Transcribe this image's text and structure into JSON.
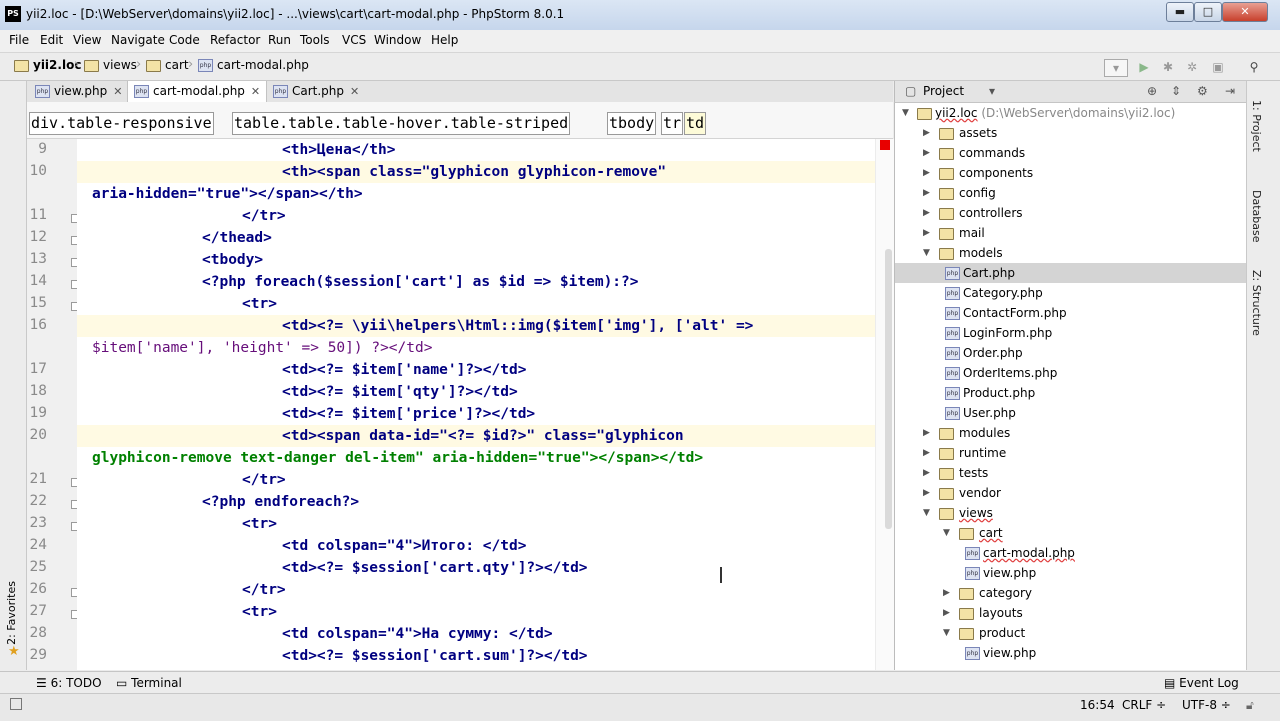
{
  "window": {
    "title": "yii2.loc - [D:\\WebServer\\domains\\yii2.loc] - ...\\views\\cart\\cart-modal.php - PhpStorm 8.0.1",
    "app_icon": "PS",
    "minimize": "▬",
    "maximize": "□",
    "close": "✕"
  },
  "menu": [
    "File",
    "Edit",
    "View",
    "Navigate",
    "Code",
    "Refactor",
    "Run",
    "Tools",
    "VCS",
    "Window",
    "Help"
  ],
  "navbar": {
    "crumbs": [
      "yii2.loc",
      "views",
      "cart",
      "cart-modal.php"
    ]
  },
  "tabs": [
    {
      "label": "view.php",
      "active": false
    },
    {
      "label": "cart-modal.php",
      "active": true
    },
    {
      "label": "Cart.php",
      "active": false
    }
  ],
  "tag_breadcrumbs": [
    "div.table-responsive",
    "table.table.table-hover.table-striped",
    "tbody",
    "tr",
    "td"
  ],
  "editor": {
    "line_numbers": [
      "9",
      "10",
      "11",
      "12",
      "13",
      "14",
      "15",
      "16",
      "17",
      "18",
      "19",
      "20",
      "21",
      "22",
      "23",
      "24",
      "25",
      "26",
      "27",
      "28",
      "29"
    ],
    "code": {
      "l9": "<th>Цена</th>",
      "l10a": "<th><span class=\"glyphicon glyphicon-remove\"",
      "l10b": "aria-hidden=\"true\"></span></th>",
      "l11": "</tr>",
      "l12": "</thead>",
      "l13": "<tbody>",
      "l14": "<?php foreach($session['cart'] as $id => $item):?>",
      "l15": "<tr>",
      "l16a": "<td><?= \\yii\\helpers\\Html::img($item['img'], ['alt' =>",
      "l16b": "$item['name'], 'height' => 50]) ?></td>",
      "l17": "<td><?= $item['name']?></td>",
      "l18": "<td><?= $item['qty']?></td>",
      "l19": "<td><?= $item['price']?></td>",
      "l20a": "<td><span data-id=\"<?= $id?>\" class=\"glyphicon",
      "l20b": "glyphicon-remove text-danger del-item\" aria-hidden=\"true\"></span></td>",
      "l21": "</tr>",
      "l22": "<?php endforeach?>",
      "l23": "<tr>",
      "l24": "<td colspan=\"4\">Итого: </td>",
      "l25": "<td><?= $session['cart.qty']?></td>",
      "l26": "</tr>",
      "l27": "<tr>",
      "l28": "<td colspan=\"4\">На сумму: </td>",
      "l29": "<td><?= $session['cart.sum']?></td>"
    }
  },
  "project": {
    "header_label": "Project",
    "root_name": "yii2.loc",
    "root_path": "(D:\\WebServer\\domains\\yii2.loc)",
    "tree": [
      {
        "label": "assets",
        "type": "folder",
        "depth": 1,
        "expanded": false
      },
      {
        "label": "commands",
        "type": "folder",
        "depth": 1,
        "expanded": false
      },
      {
        "label": "components",
        "type": "folder",
        "depth": 1,
        "expanded": false
      },
      {
        "label": "config",
        "type": "folder",
        "depth": 1,
        "expanded": false
      },
      {
        "label": "controllers",
        "type": "folder",
        "depth": 1,
        "expanded": false
      },
      {
        "label": "mail",
        "type": "folder",
        "depth": 1,
        "expanded": false
      },
      {
        "label": "models",
        "type": "folder",
        "depth": 1,
        "expanded": true
      },
      {
        "label": "Cart.php",
        "type": "php",
        "depth": 2,
        "selected": true
      },
      {
        "label": "Category.php",
        "type": "php",
        "depth": 2
      },
      {
        "label": "ContactForm.php",
        "type": "php",
        "depth": 2
      },
      {
        "label": "LoginForm.php",
        "type": "php",
        "depth": 2
      },
      {
        "label": "Order.php",
        "type": "php",
        "depth": 2
      },
      {
        "label": "OrderItems.php",
        "type": "php",
        "depth": 2
      },
      {
        "label": "Product.php",
        "type": "php",
        "depth": 2
      },
      {
        "label": "User.php",
        "type": "php",
        "depth": 2
      },
      {
        "label": "modules",
        "type": "folder",
        "depth": 1,
        "expanded": false
      },
      {
        "label": "runtime",
        "type": "folder",
        "depth": 1,
        "expanded": false
      },
      {
        "label": "tests",
        "type": "folder",
        "depth": 1,
        "expanded": false
      },
      {
        "label": "vendor",
        "type": "folder",
        "depth": 1,
        "expanded": false
      },
      {
        "label": "views",
        "type": "folder",
        "depth": 1,
        "expanded": true,
        "error": true
      },
      {
        "label": "cart",
        "type": "folder",
        "depth": 2,
        "expanded": true,
        "error": true
      },
      {
        "label": "cart-modal.php",
        "type": "php",
        "depth": 3,
        "error": true
      },
      {
        "label": "view.php",
        "type": "php",
        "depth": 3
      },
      {
        "label": "category",
        "type": "folder",
        "depth": 2,
        "expanded": false
      },
      {
        "label": "layouts",
        "type": "folder",
        "depth": 2,
        "expanded": false
      },
      {
        "label": "product",
        "type": "folder",
        "depth": 2,
        "expanded": true
      },
      {
        "label": "view.php",
        "type": "php",
        "depth": 3
      }
    ]
  },
  "side_tabs": {
    "left_favorites": "2: Favorites",
    "right_project": "1: Project",
    "right_database": "Database",
    "right_structure": "Z: Structure"
  },
  "bottom_tools": {
    "todo": "6: TODO",
    "terminal": "Terminal",
    "event_log": "Event Log"
  },
  "status": {
    "position": "16:54",
    "line_sep": "CRLF ÷",
    "encoding": "UTF-8 ÷"
  },
  "colors": {
    "tag": "#000080",
    "string": "#008000",
    "variable": "#660e7a",
    "selection": "#d4d4d4"
  }
}
